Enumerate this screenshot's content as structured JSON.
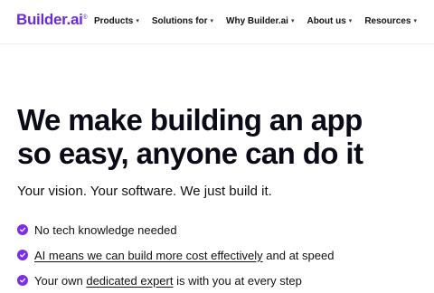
{
  "brand": {
    "name": "Builder.ai",
    "mark": "®",
    "color": "#6c2bd9"
  },
  "nav": {
    "items": [
      {
        "label": "Products"
      },
      {
        "label": "Solutions for"
      },
      {
        "label": "Why Builder.ai"
      },
      {
        "label": "About us"
      },
      {
        "label": "Resources"
      }
    ],
    "caret_icon": "chevron-down-icon"
  },
  "hero": {
    "headline_line1": "We make building an app",
    "headline_line2": "so easy, anyone can do it",
    "subhead": "Your vision. Your software. We just build it.",
    "check_color": "#7b2fe6",
    "checks": [
      {
        "text": "No tech knowledge needed"
      },
      {
        "link": "AI means we can build more cost effectively",
        "suffix": " and at speed"
      },
      {
        "prefix": "Your own ",
        "link": "dedicated expert",
        "suffix": " is with you at every step"
      }
    ]
  }
}
